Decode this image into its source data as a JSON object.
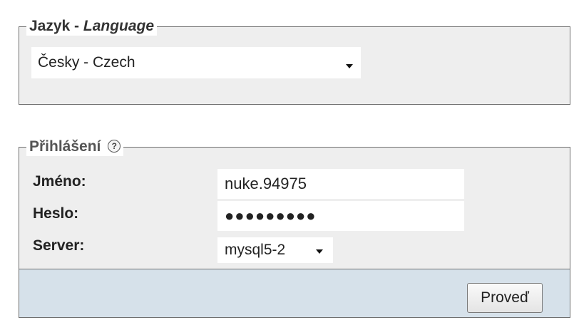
{
  "language": {
    "legend_main": "Jazyk",
    "legend_sep": " - ",
    "legend_italic": "Language",
    "selected": "Česky - Czech"
  },
  "login": {
    "legend": "Přihlášení",
    "help_icon_glyph": "?",
    "username_label": "Jméno:",
    "username_value": "nuke.94975",
    "password_label": "Heslo:",
    "password_mask": "●●●●●●●●●",
    "server_label": "Server:",
    "server_selected": "mysql5-2",
    "submit_label": "Proveď"
  },
  "colors": {
    "panel_bg": "#eeeeee",
    "submit_bar_bg": "#d6e1ea",
    "border": "#6f6f6f"
  }
}
